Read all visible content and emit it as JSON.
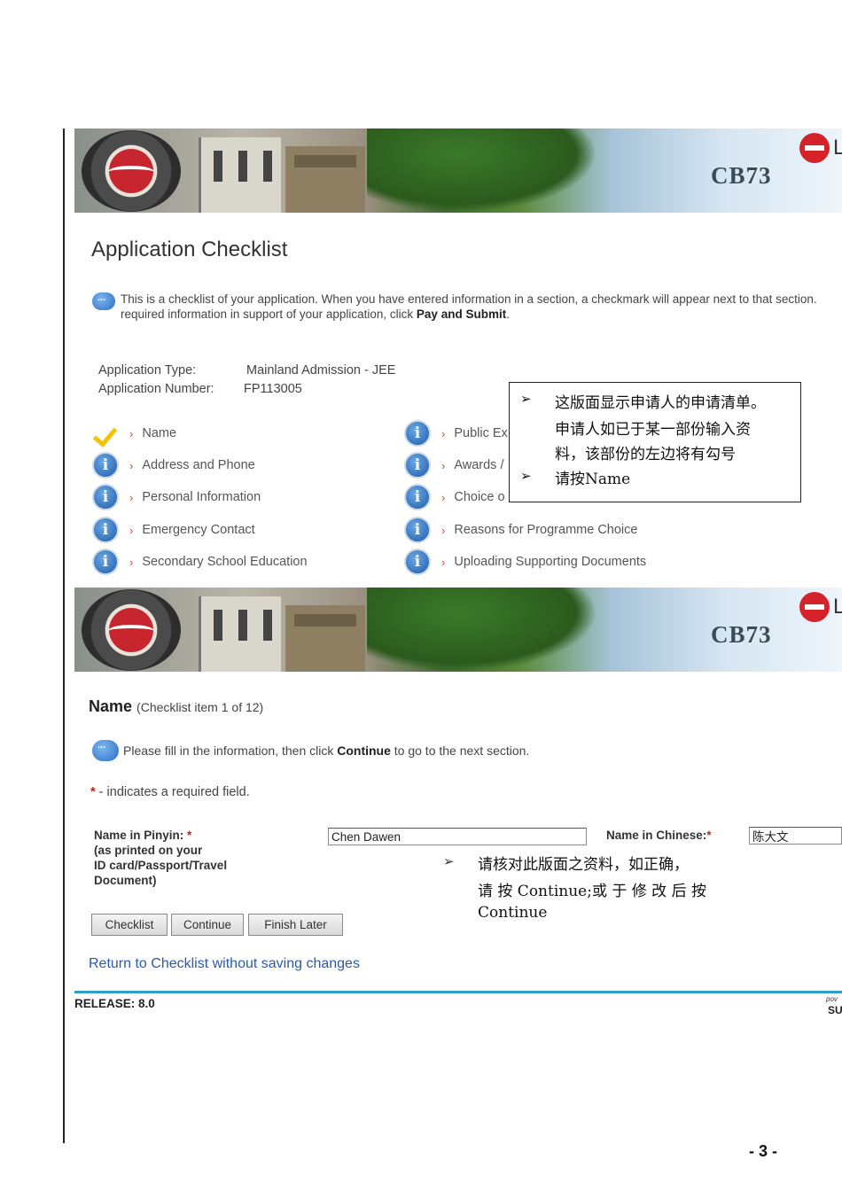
{
  "banner": {
    "code": "CB73",
    "logo_letter": "L"
  },
  "checklist": {
    "title": "Application Checklist",
    "intro_text": "This is a checklist of your application. When you have entered information in a section, a checkmark will appear next to that section.",
    "intro_text2_prefix": "required information in support of your application, click ",
    "intro_text2_bold": "Pay and Submit",
    "intro_text2_suffix": ".",
    "app_type_label": "Application Type:",
    "app_type_value": "Mainland Admission - JEE",
    "app_number_label": "Application Number:",
    "app_number_value": "FP113005",
    "left_items": [
      {
        "label": "Name",
        "status": "complete"
      },
      {
        "label": "Address and Phone",
        "status": "info"
      },
      {
        "label": "Personal Information",
        "status": "info"
      },
      {
        "label": "Emergency Contact",
        "status": "info"
      },
      {
        "label": "Secondary School Education",
        "status": "info"
      }
    ],
    "right_items": [
      {
        "label": "Public Ex",
        "status": "info"
      },
      {
        "label": "Awards /",
        "status": "info"
      },
      {
        "label": "Choice o",
        "status": "info"
      },
      {
        "label": "Reasons for Programme Choice",
        "status": "info"
      },
      {
        "label": "Uploading Supporting Documents",
        "status": "info"
      }
    ],
    "note_lines": [
      "这版面显示申请人的申请清单。",
      "申请人如已于某一部份输入资",
      "料，该部份的左边将有勾号",
      "请按Name"
    ],
    "arrow_glyph": "➢"
  },
  "name_section": {
    "title": "Name",
    "subtitle": "(Checklist item 1 of 12)",
    "info_prefix": "Please fill in the information, then click ",
    "info_bold": "Continue",
    "info_suffix": " to go to the next section.",
    "required_star": "*",
    "required_text": " - indicates a required field.",
    "pinyin_label": "Name in Pinyin:",
    "pinyin_sub": [
      "(as printed on your",
      "ID card/Passport/Travel",
      "Document)"
    ],
    "pinyin_value": "Chen Dawen",
    "chinese_label": "Name in Chinese:",
    "chinese_value": "陈大文",
    "buttons": {
      "checklist": "Checklist",
      "continue": "Continue",
      "finish_later": "Finish Later"
    },
    "return_link": "Return to Checklist without saving changes",
    "note_lines": [
      "请核对此版面之资料，如正确，",
      "请 按 Continue;或 于 修 改 后 按",
      "Continue"
    ]
  },
  "footer": {
    "release": "RELEASE: 8.0",
    "powered": "pov",
    "brand": "SU",
    "page_number": "- 3 -"
  },
  "colors": {
    "accent_link": "#2a5aa8",
    "rule": "#2fa0c8",
    "required": "#c82020",
    "check": "#f2c300"
  }
}
